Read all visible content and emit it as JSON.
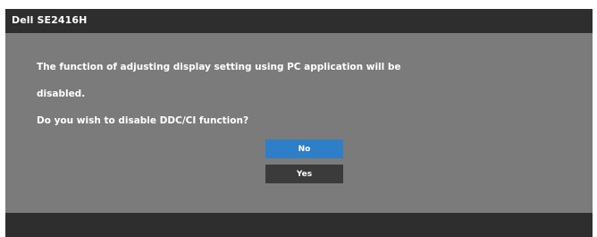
{
  "window": {
    "title": "Dell SE2416H"
  },
  "dialog": {
    "message_line1": "The function of adjusting display setting using PC application will be",
    "message_line2": "disabled.",
    "question": "Do you wish to disable DDC/CI function?",
    "buttons": [
      {
        "label": "No",
        "selected": true
      },
      {
        "label": "Yes",
        "selected": false
      }
    ]
  },
  "colors": {
    "frame": "#2e2e2e",
    "panel": "#7b7b7b",
    "selected_button": "#2e7fc8",
    "unselected_button": "#3b3b3b",
    "text": "#ffffff"
  }
}
